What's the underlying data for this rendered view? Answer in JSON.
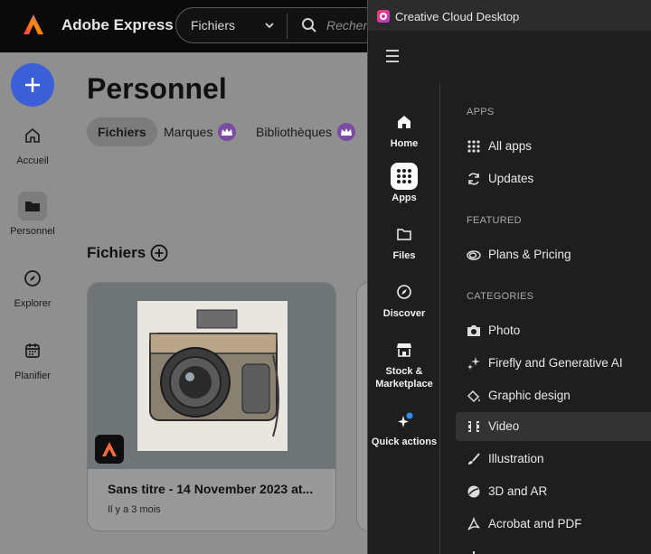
{
  "express": {
    "brand": "Adobe Express",
    "search": {
      "scope": "Fichiers",
      "placeholder": "Recherch"
    },
    "rail": {
      "create_label": "+",
      "items": [
        {
          "label": "Accueil",
          "icon": "home-icon"
        },
        {
          "label": "Personnel",
          "icon": "folder-icon",
          "active": true
        },
        {
          "label": "Explorer",
          "icon": "compass-icon"
        },
        {
          "label": "Planifier",
          "icon": "calendar-icon"
        }
      ]
    },
    "page_title": "Personnel",
    "tabs": [
      {
        "label": "Fichiers",
        "active": true
      },
      {
        "label": "Marques",
        "premium": true
      },
      {
        "label": "Bibliothèques",
        "premium": true
      }
    ],
    "section_title": "Fichiers",
    "card": {
      "title": "Sans titre - 14 November 2023 at...",
      "subtitle": "Il y a 3 mois"
    },
    "colors": {
      "topbar": "#0a0a0a",
      "accent": "#3b5fd6",
      "premium": "#7a4ca3"
    }
  },
  "cc": {
    "window_title": "Creative Cloud Desktop",
    "nav": [
      {
        "label": "Home",
        "icon": "home-icon"
      },
      {
        "label": "Apps",
        "icon": "apps-grid-icon",
        "active": true
      },
      {
        "label": "Files",
        "icon": "folder-icon"
      },
      {
        "label": "Discover",
        "icon": "compass-icon"
      },
      {
        "label": "Stock &\nMarketplace",
        "icon": "storefront-icon"
      },
      {
        "label": "Quick actions",
        "icon": "sparkle-icon",
        "badge": true
      }
    ],
    "sections": {
      "apps": {
        "heading": "APPS",
        "items": [
          {
            "label": "All apps",
            "icon": "grid-icon"
          },
          {
            "label": "Updates",
            "icon": "refresh-icon"
          }
        ]
      },
      "featured": {
        "heading": "FEATURED",
        "items": [
          {
            "label": "Plans & Pricing",
            "icon": "cc-logo-icon"
          }
        ]
      },
      "categories": {
        "heading": "CATEGORIES",
        "items": [
          {
            "label": "Photo",
            "icon": "camera-icon"
          },
          {
            "label": "Firefly and Generative AI",
            "icon": "sparkles-icon"
          },
          {
            "label": "Graphic design",
            "icon": "paint-bucket-icon"
          },
          {
            "label": "Video",
            "icon": "film-icon",
            "active": true
          },
          {
            "label": "Illustration",
            "icon": "brush-icon"
          },
          {
            "label": "3D and AR",
            "icon": "sphere-icon"
          },
          {
            "label": "Acrobat and PDF",
            "icon": "acrobat-icon"
          }
        ]
      }
    },
    "colors": {
      "background": "#1e1e1e",
      "titlebar": "#2c2c2c",
      "active_item": "#333333"
    }
  }
}
